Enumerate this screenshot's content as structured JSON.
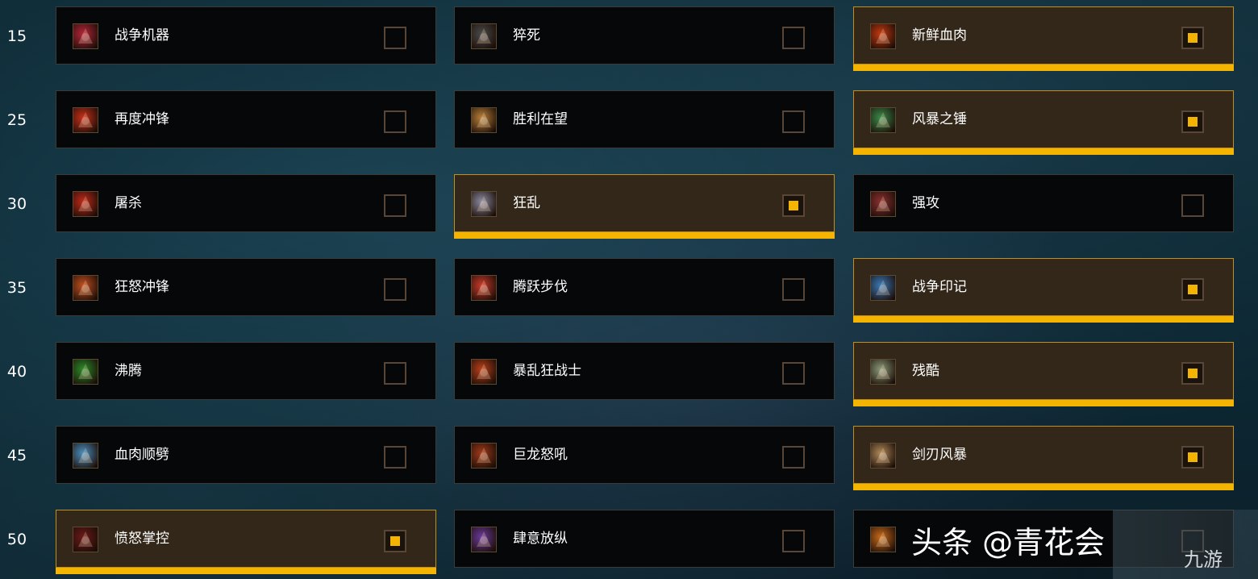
{
  "rows": [
    {
      "level": "15",
      "talents": [
        {
          "name": "战争机器",
          "selected": false,
          "icon": "war-machine-icon",
          "icon_color": "#b5263a"
        },
        {
          "name": "猝死",
          "selected": false,
          "icon": "sudden-death-icon",
          "icon_color": "#4a4a4a"
        },
        {
          "name": "新鲜血肉",
          "selected": true,
          "icon": "fresh-meat-icon",
          "icon_color": "#c43a10"
        }
      ]
    },
    {
      "level": "25",
      "talents": [
        {
          "name": "再度冲锋",
          "selected": false,
          "icon": "double-time-icon",
          "icon_color": "#c8301a"
        },
        {
          "name": "胜利在望",
          "selected": false,
          "icon": "impending-victory-icon",
          "icon_color": "#b8803a"
        },
        {
          "name": "风暴之锤",
          "selected": true,
          "icon": "storm-bolt-icon",
          "icon_color": "#3a8a4a"
        }
      ]
    },
    {
      "level": "30",
      "talents": [
        {
          "name": "屠杀",
          "selected": false,
          "icon": "massacre-icon",
          "icon_color": "#c02a1a"
        },
        {
          "name": "狂乱",
          "selected": true,
          "icon": "frenzy-icon",
          "icon_color": "#8a8aa0"
        },
        {
          "name": "强攻",
          "selected": false,
          "icon": "onslaught-icon",
          "icon_color": "#8a3030"
        }
      ]
    },
    {
      "level": "35",
      "talents": [
        {
          "name": "狂怒冲锋",
          "selected": false,
          "icon": "furious-charge-icon",
          "icon_color": "#c05020"
        },
        {
          "name": "腾跃步伐",
          "selected": false,
          "icon": "bounding-stride-icon",
          "icon_color": "#c83a2a"
        },
        {
          "name": "战争印记",
          "selected": true,
          "icon": "warpaint-icon",
          "icon_color": "#3a7ab8"
        }
      ]
    },
    {
      "level": "40",
      "talents": [
        {
          "name": "沸腾",
          "selected": false,
          "icon": "seethe-icon",
          "icon_color": "#2a8a2a"
        },
        {
          "name": "暴乱狂战士",
          "selected": false,
          "icon": "frothing-berserker-icon",
          "icon_color": "#b8401a"
        },
        {
          "name": "残酷",
          "selected": true,
          "icon": "cruelty-icon",
          "icon_color": "#8a9a7a"
        }
      ]
    },
    {
      "level": "45",
      "talents": [
        {
          "name": "血肉顺劈",
          "selected": false,
          "icon": "meat-cleaver-icon",
          "icon_color": "#4a90c0"
        },
        {
          "name": "巨龙怒吼",
          "selected": false,
          "icon": "dragon-roar-icon",
          "icon_color": "#a03a1a"
        },
        {
          "name": "剑刃风暴",
          "selected": true,
          "icon": "bladestorm-icon",
          "icon_color": "#b08a5a"
        }
      ]
    },
    {
      "level": "50",
      "talents": [
        {
          "name": "愤怒掌控",
          "selected": true,
          "icon": "anger-management-icon",
          "icon_color": "#6a1a1a"
        },
        {
          "name": "肆意放纵",
          "selected": false,
          "icon": "reckless-abandon-icon",
          "icon_color": "#6a3a9a"
        },
        {
          "name": "",
          "selected": false,
          "icon": "siegebreaker-icon",
          "icon_color": "#c86a1a"
        }
      ]
    }
  ],
  "watermark": {
    "text": "头条 @青花会",
    "logo": "九游"
  }
}
